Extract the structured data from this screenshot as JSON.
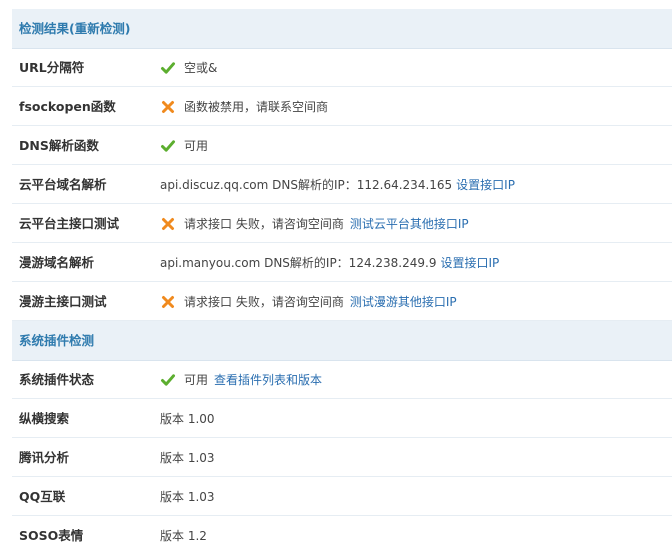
{
  "sections": [
    {
      "title": "检测结果(重新检测)",
      "rows": [
        {
          "label": "URL分隔符",
          "status": "ok",
          "text": "空或&",
          "link": ""
        },
        {
          "label": "fsockopen函数",
          "status": "fail",
          "text": "函数被禁用，请联系空间商",
          "link": ""
        },
        {
          "label": "DNS解析函数",
          "status": "ok",
          "text": "可用",
          "link": ""
        },
        {
          "label": "云平台域名解析",
          "status": "none",
          "text": "api.discuz.qq.com DNS解析的IP：112.64.234.165",
          "link": "设置接口IP"
        },
        {
          "label": "云平台主接口测试",
          "status": "fail",
          "text": "请求接口 失败，请咨询空间商",
          "link": "测试云平台其他接口IP"
        },
        {
          "label": "漫游域名解析",
          "status": "none",
          "text": "api.manyou.com DNS解析的IP：124.238.249.9",
          "link": "设置接口IP"
        },
        {
          "label": "漫游主接口测试",
          "status": "fail",
          "text": "请求接口 失败，请咨询空间商",
          "link": "测试漫游其他接口IP"
        }
      ]
    },
    {
      "title": "系统插件检测",
      "rows": [
        {
          "label": "系统插件状态",
          "status": "ok",
          "text": "可用",
          "link": "查看插件列表和版本"
        },
        {
          "label": "纵横搜索",
          "status": "none",
          "text": "版本 1.00",
          "link": ""
        },
        {
          "label": "腾讯分析",
          "status": "none",
          "text": "版本 1.03",
          "link": ""
        },
        {
          "label": "QQ互联",
          "status": "none",
          "text": "版本 1.03",
          "link": ""
        },
        {
          "label": "SOSO表情",
          "status": "none",
          "text": "版本 1.2",
          "link": ""
        }
      ]
    }
  ],
  "colors": {
    "header_bg": "#eaf1f7",
    "header_text": "#2f7bae",
    "link": "#2a6eb0",
    "ok": "#5cae2f",
    "fail": "#f08a1e"
  },
  "icons": {
    "ok": "check-icon",
    "fail": "cross-icon"
  }
}
